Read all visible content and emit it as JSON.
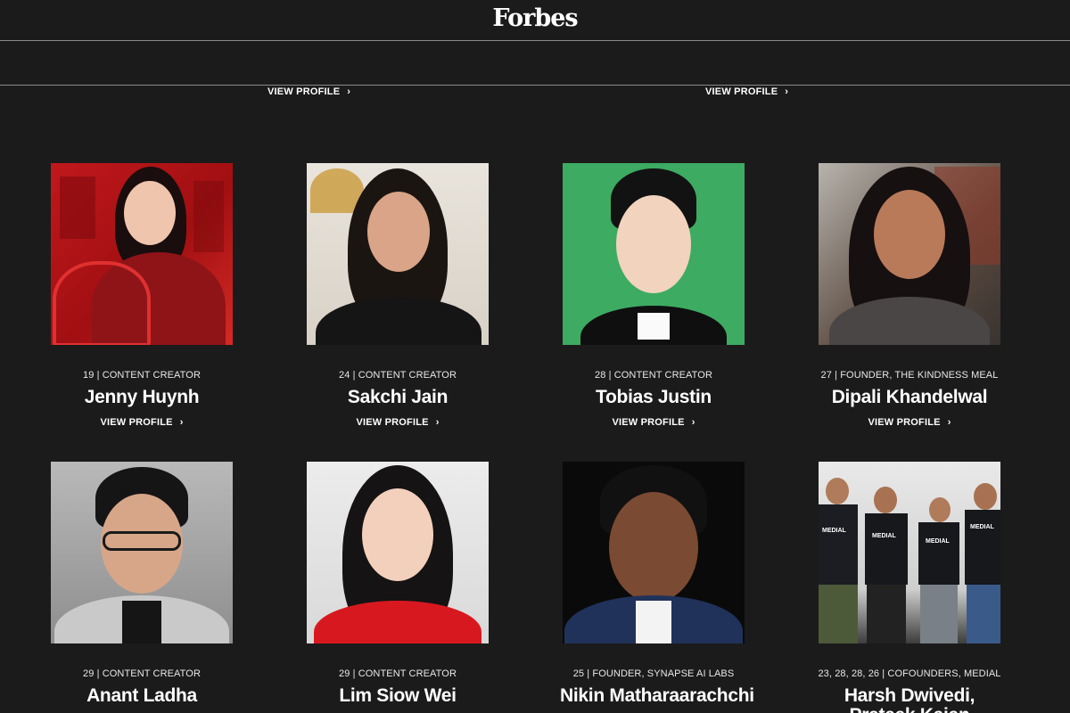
{
  "header": {
    "logo": "Forbes"
  },
  "prev_row": [
    {
      "view_label": "VIEW PROFILE"
    },
    {
      "view_label": "VIEW PROFILE"
    }
  ],
  "row1": [
    {
      "meta": "19 | CONTENT CREATOR",
      "name": "Jenny Huynh",
      "view_label": "VIEW PROFILE"
    },
    {
      "meta": "24 | CONTENT CREATOR",
      "name": "Sakchi Jain",
      "view_label": "VIEW PROFILE"
    },
    {
      "meta": "28 | CONTENT CREATOR",
      "name": "Tobias Justin",
      "view_label": "VIEW PROFILE"
    },
    {
      "meta": "27 | FOUNDER, THE KINDNESS MEAL",
      "name": "Dipali Khandelwal",
      "view_label": "VIEW PROFILE"
    }
  ],
  "row2": [
    {
      "meta": "29 | CONTENT CREATOR",
      "name": "Anant Ladha"
    },
    {
      "meta": "29 | CONTENT CREATOR",
      "name": "Lim Siow Wei"
    },
    {
      "meta": "25 | FOUNDER, SYNAPSE AI LABS",
      "name": "Nikin Matharaarachchi"
    },
    {
      "meta": "23, 28, 28, 26 | COFOUNDERS, MEDIAL",
      "name": "Harsh Dwivedi,",
      "name_cont": "Prateek Kaian"
    }
  ],
  "shirt_text": "MEDIAL",
  "icons": {
    "chevron": "chevron-right-icon"
  }
}
